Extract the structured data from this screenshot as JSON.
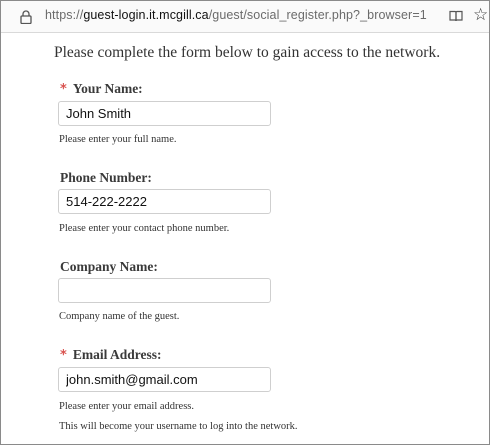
{
  "browser": {
    "url_scheme": "https://",
    "url_host": "guest-login.it.mcgill.ca",
    "url_path": "/guest/social_register.php?_browser=1",
    "icons": [
      "lock-icon",
      "reader-view-icon",
      "bookmark-star-icon"
    ]
  },
  "form": {
    "intro": "Please complete the form below to gain access to the network.",
    "required_marker": "*",
    "fields": {
      "name": {
        "label": "Your Name:",
        "value": "John Smith",
        "help": "Please enter your full name."
      },
      "phone": {
        "label": "Phone Number:",
        "value": "514-222-2222",
        "help": "Please enter your contact phone number."
      },
      "company": {
        "label": "Company Name:",
        "value": "",
        "help": "Company name of the guest."
      },
      "email": {
        "label": "Email Address:",
        "value": "john.smith@gmail.com",
        "help": "Please enter your email address.",
        "help2": "This will become your username to log into the network."
      }
    }
  },
  "colors": {
    "required": "#d9534f",
    "text": "#333333",
    "field_border": "#cfcfcf"
  }
}
